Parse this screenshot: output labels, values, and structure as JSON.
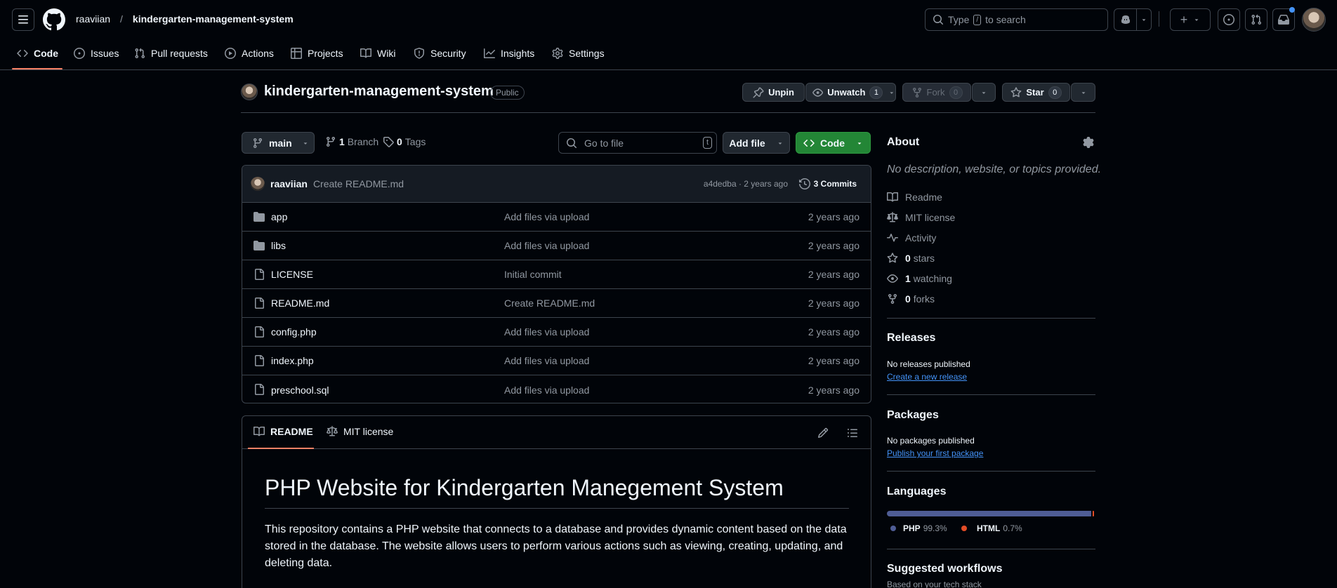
{
  "header": {
    "owner": "raaviian",
    "separator": "/",
    "repo": "kindergarten-management-system",
    "search_prefix": "Type",
    "search_key": "/",
    "search_suffix": "to search",
    "plus_label": "+"
  },
  "nav": {
    "tabs": [
      "Code",
      "Issues",
      "Pull requests",
      "Actions",
      "Projects",
      "Wiki",
      "Security",
      "Insights",
      "Settings"
    ]
  },
  "repo": {
    "name": "kindergarten-management-system",
    "visibility": "Public",
    "unpin": "Unpin",
    "unwatch": "Unwatch",
    "watch_count": "1",
    "fork": "Fork",
    "fork_count": "0",
    "star": "Star",
    "star_count": "0"
  },
  "toolbar": {
    "branch": "main",
    "branch_count": "1",
    "branch_label": "Branch",
    "tag_count": "0",
    "tag_label": "Tags",
    "goto_placeholder": "Go to file",
    "goto_key": "t",
    "add_file": "Add file",
    "code": "Code"
  },
  "commit": {
    "author": "raaviian",
    "message": "Create README.md",
    "sha_time": "a4dedba · 2 years ago",
    "count": "3 Commits"
  },
  "files": [
    {
      "name": "app",
      "type": "dir",
      "message": "Add files via upload",
      "date": "2 years ago"
    },
    {
      "name": "libs",
      "type": "dir",
      "message": "Add files via upload",
      "date": "2 years ago"
    },
    {
      "name": "LICENSE",
      "type": "file",
      "message": "Initial commit",
      "date": "2 years ago"
    },
    {
      "name": "README.md",
      "type": "file",
      "message": "Create README.md",
      "date": "2 years ago"
    },
    {
      "name": "config.php",
      "type": "file",
      "message": "Add files via upload",
      "date": "2 years ago"
    },
    {
      "name": "index.php",
      "type": "file",
      "message": "Add files via upload",
      "date": "2 years ago"
    },
    {
      "name": "preschool.sql",
      "type": "file",
      "message": "Add files via upload",
      "date": "2 years ago"
    }
  ],
  "readme": {
    "tab_readme": "README",
    "tab_license": "MIT license",
    "title": "PHP Website for Kindergarten Manegement System",
    "paragraph": "This repository contains a PHP website that connects to a database and provides dynamic content based on the data stored in the database. The website allows users to perform various actions such as viewing, creating, updating, and deleting data."
  },
  "about": {
    "heading": "About",
    "description": "No description, website, or topics provided.",
    "readme": "Readme",
    "license": "MIT license",
    "activity": "Activity",
    "stars_count": "0",
    "stars_label": "stars",
    "watching_count": "1",
    "watching_label": "watching",
    "forks_count": "0",
    "forks_label": "forks"
  },
  "releases": {
    "heading": "Releases",
    "text": "No releases published",
    "link": "Create a new release"
  },
  "packages": {
    "heading": "Packages",
    "text": "No packages published",
    "link": "Publish your first package"
  },
  "languages": {
    "heading": "Languages",
    "items": [
      {
        "name": "PHP",
        "percent": "99.3%",
        "value": 99.3,
        "color": "#4F5D95"
      },
      {
        "name": "HTML",
        "percent": "0.7%",
        "value": 0.7,
        "color": "#e34c26"
      }
    ]
  },
  "workflows": {
    "heading": "Suggested workflows",
    "subtext": "Based on your tech stack"
  },
  "colors": {
    "accent_green": "#238636",
    "nav_underline": "#f78166",
    "notification_dot": "#4493f8"
  }
}
